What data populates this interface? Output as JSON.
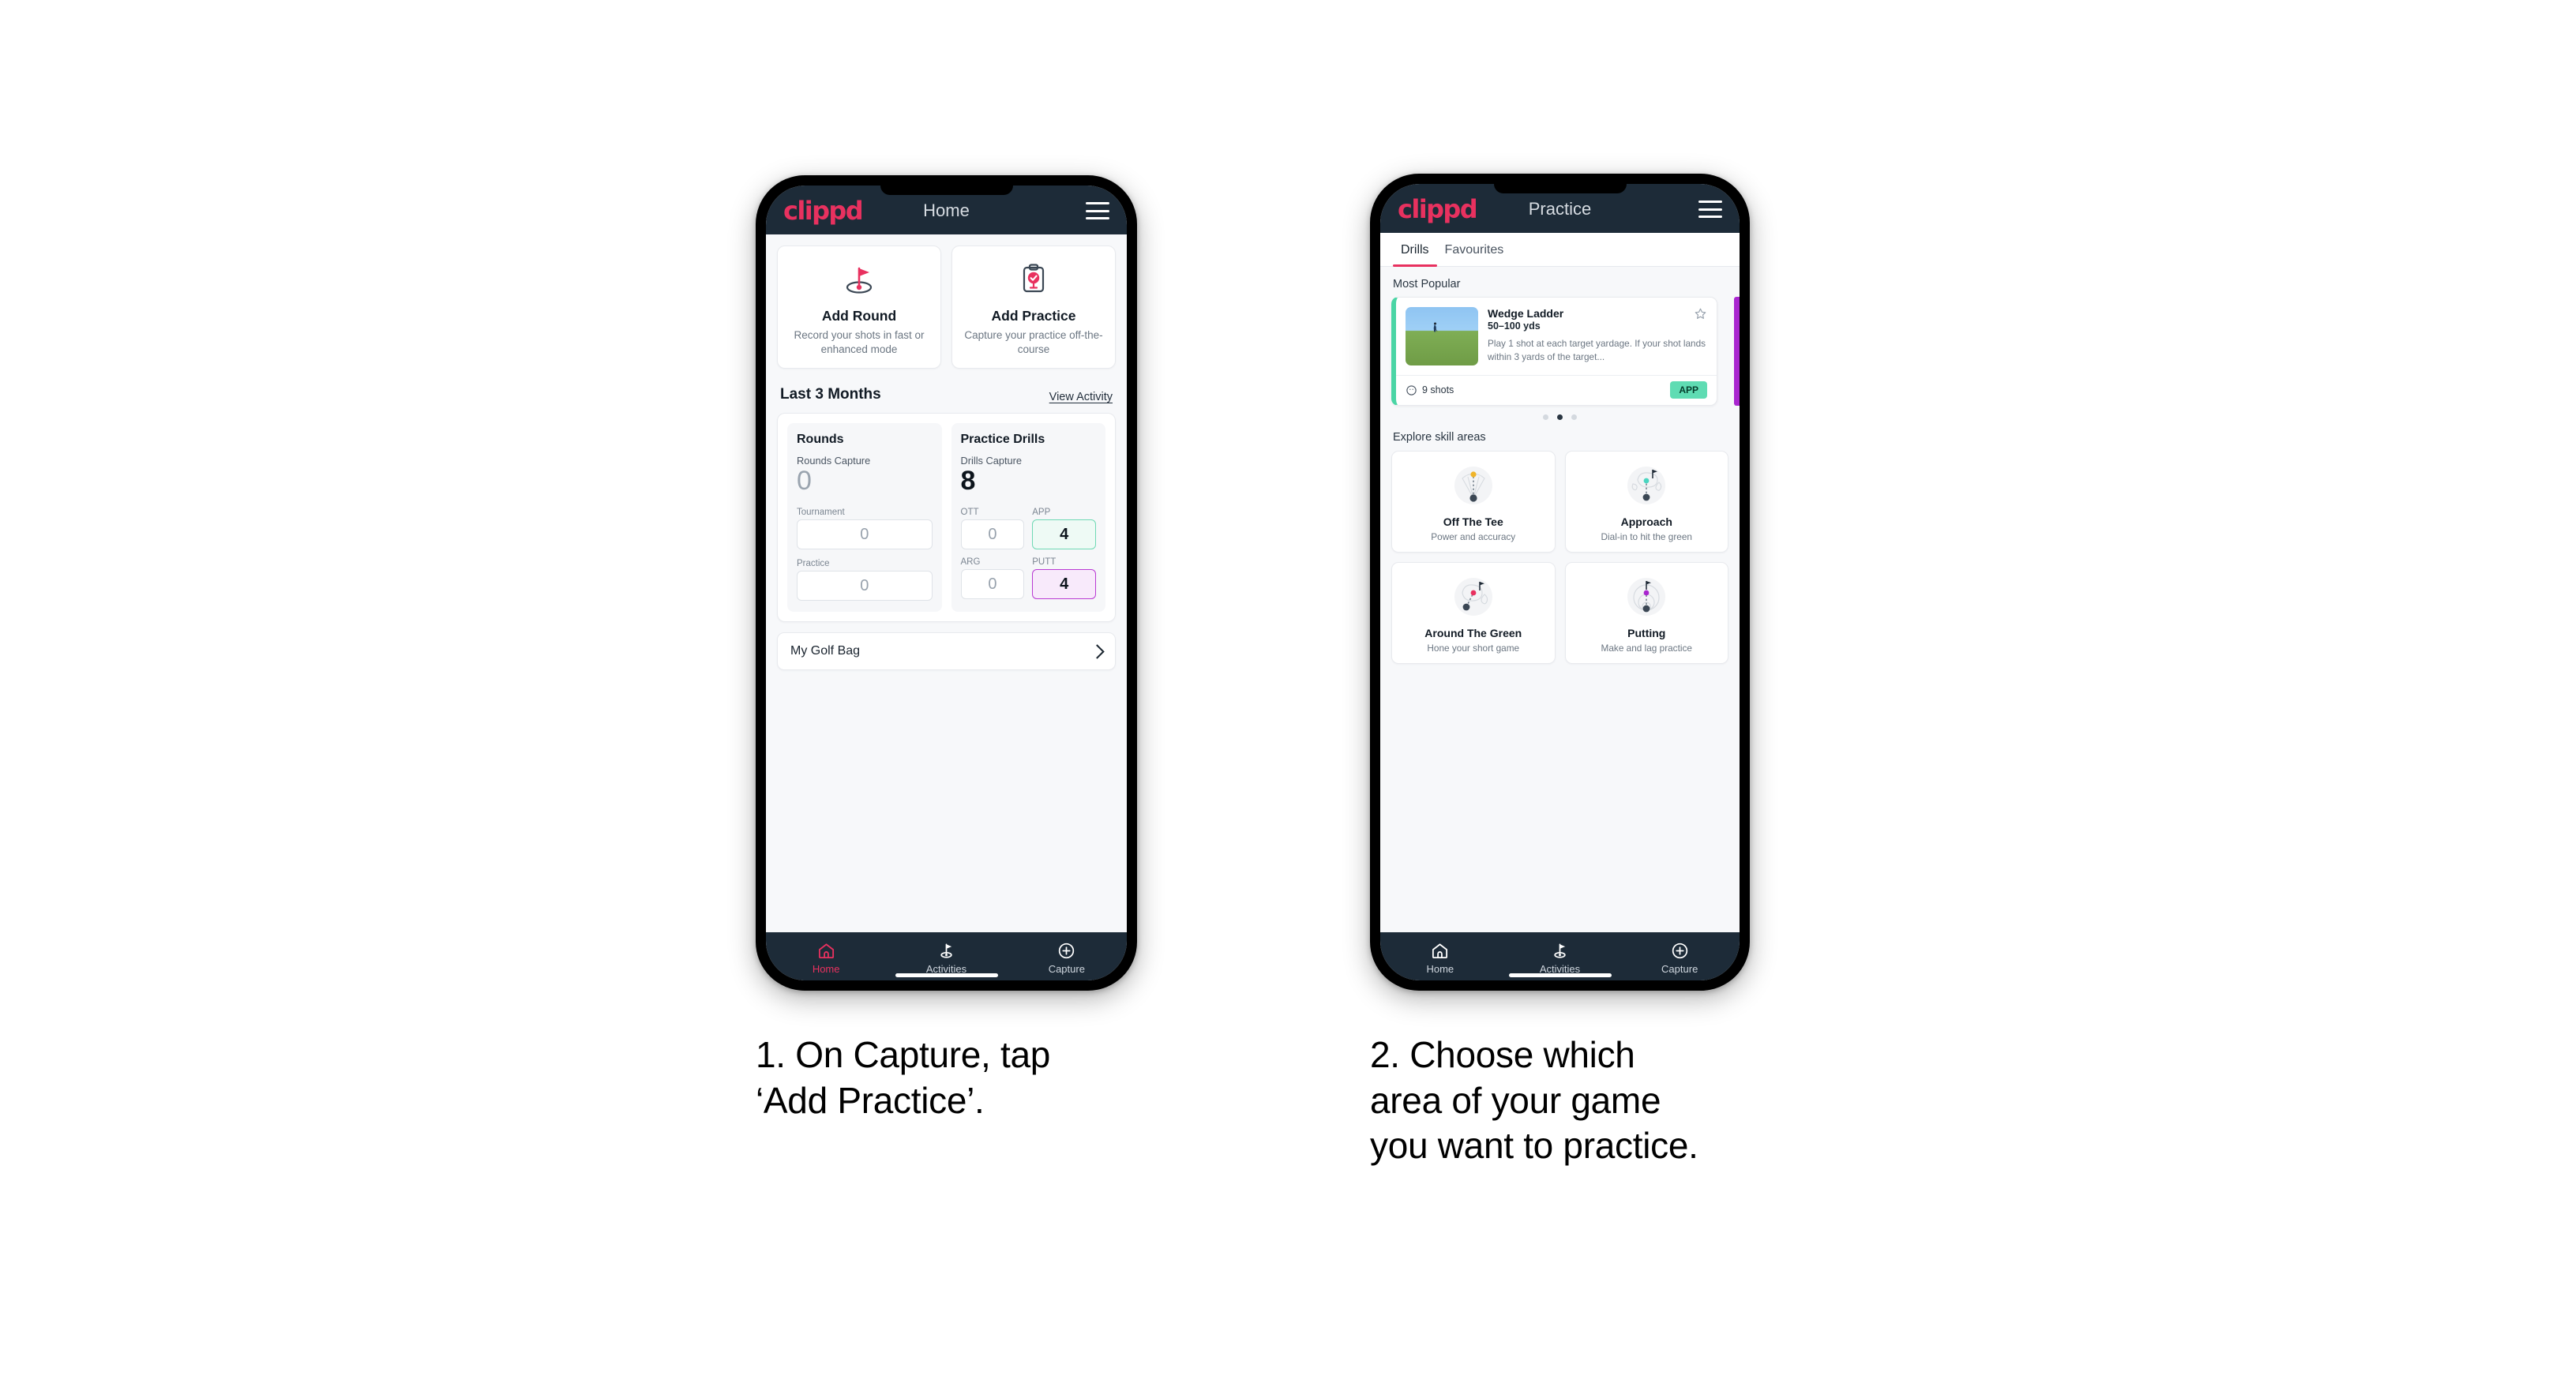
{
  "brand": "clippd",
  "phone1": {
    "appbar": {
      "title": "Home",
      "menu_icon": "hamburger-icon"
    },
    "actions": [
      {
        "icon": "golf-flag-icon",
        "title": "Add Round",
        "sub": "Record your shots in fast or enhanced mode"
      },
      {
        "icon": "clipboard-check-icon",
        "title": "Add Practice",
        "sub": "Capture your practice off-the-course"
      }
    ],
    "section": {
      "title": "Last 3 Months",
      "link": "View Activity"
    },
    "rounds": {
      "panel_title": "Rounds",
      "capture_label": "Rounds Capture",
      "capture_value": "0",
      "items": [
        {
          "label": "Tournament",
          "value": "0",
          "state": "default"
        },
        {
          "label": "Practice",
          "value": "0",
          "state": "default"
        }
      ]
    },
    "drills": {
      "panel_title": "Practice Drills",
      "capture_label": "Drills Capture",
      "capture_value": "8",
      "items": [
        {
          "label": "OTT",
          "value": "0",
          "state": "default"
        },
        {
          "label": "APP",
          "value": "4",
          "state": "app"
        },
        {
          "label": "ARG",
          "value": "0",
          "state": "default"
        },
        {
          "label": "PUTT",
          "value": "4",
          "state": "putt"
        }
      ]
    },
    "golf_bag": {
      "label": "My Golf Bag",
      "chevron": "chevron-right-icon"
    },
    "nav": [
      {
        "icon": "home-icon",
        "label": "Home",
        "active": true
      },
      {
        "icon": "golf-flag-icon",
        "label": "Activities",
        "active": false
      },
      {
        "icon": "plus-circle-icon",
        "label": "Capture",
        "active": false
      }
    ]
  },
  "phone2": {
    "appbar": {
      "title": "Practice",
      "menu_icon": "hamburger-icon"
    },
    "tabs": [
      {
        "label": "Drills",
        "active": true
      },
      {
        "label": "Favourites",
        "active": false
      }
    ],
    "most_popular_heading": "Most Popular",
    "drill": {
      "title": "Wedge Ladder",
      "yardage": "50–100 yds",
      "description": "Play 1 shot at each target yardage. If your shot lands within 3 yards of the target...",
      "shots": "9 shots",
      "badge": "APP",
      "badge_color": "#5fdcb3",
      "accent_color": "#4ad5a5",
      "favourite_icon": "star-outline-icon",
      "shots_icon": "clock-icon",
      "thumbnail": "golfer-chipping-photo"
    },
    "carousel_dots": {
      "count": 3,
      "active_index": 1
    },
    "explore_heading": "Explore skill areas",
    "skills": [
      {
        "icon": "off-the-tee-icon",
        "title": "Off The Tee",
        "sub": "Power and accuracy",
        "accent": "#f0b429"
      },
      {
        "icon": "approach-icon",
        "title": "Approach",
        "sub": "Dial-in to hit the green",
        "accent": "#4ad5c0"
      },
      {
        "icon": "around-the-green-icon",
        "title": "Around The Green",
        "sub": "Hone your short game",
        "accent": "#e8315f"
      },
      {
        "icon": "putting-icon",
        "title": "Putting",
        "sub": "Make and lag practice",
        "accent": "#a926cf"
      }
    ],
    "nav": [
      {
        "icon": "home-icon",
        "label": "Home",
        "active": false
      },
      {
        "icon": "golf-flag-icon",
        "label": "Activities",
        "active": false
      },
      {
        "icon": "plus-circle-icon",
        "label": "Capture",
        "active": false
      }
    ]
  },
  "captions": {
    "step1": "1. On Capture, tap\n‘Add Practice’.",
    "step2": "2. Choose which\narea of your game\nyou want to practice."
  },
  "colors": {
    "brand_pink": "#e8315f",
    "navy": "#1d2b38",
    "app_green": "#4ad5a5",
    "putt_purple": "#a926cf",
    "page_bg": "#f7f8fa"
  }
}
